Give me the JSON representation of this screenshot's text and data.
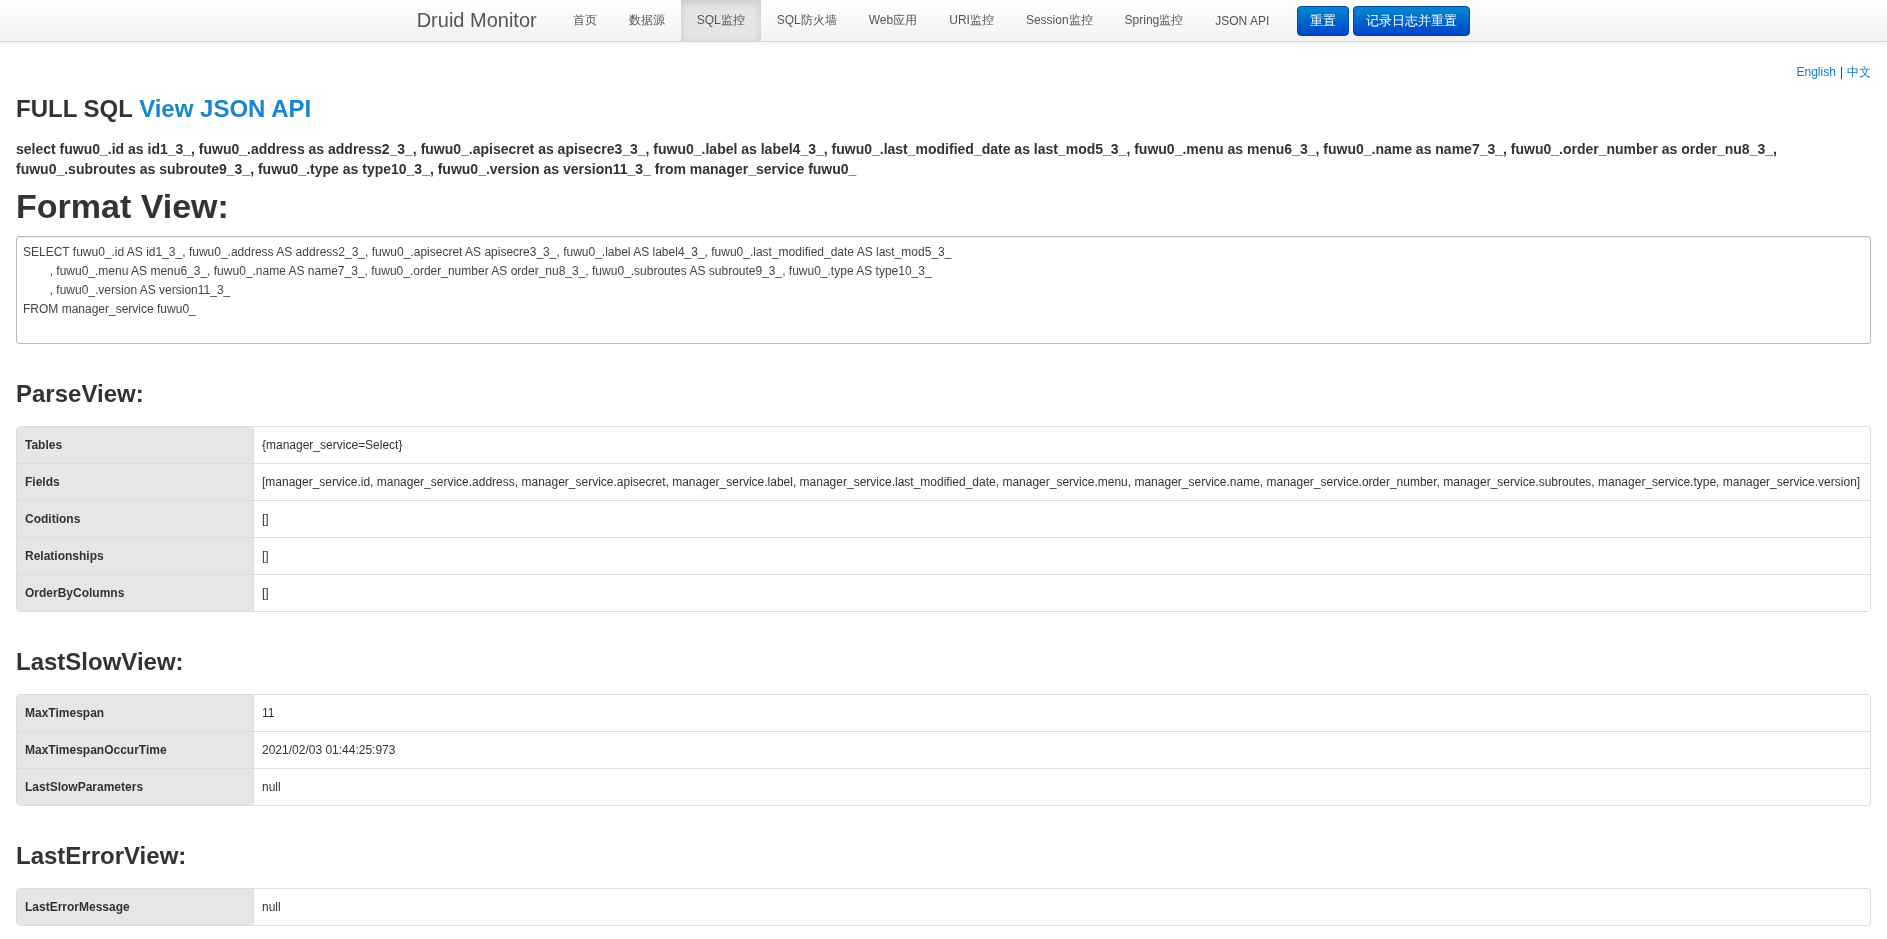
{
  "navbar": {
    "brand": "Druid Monitor",
    "items": [
      {
        "label": "首页",
        "selected": false
      },
      {
        "label": "数据源",
        "selected": false
      },
      {
        "label": "SQL监控",
        "selected": true
      },
      {
        "label": "SQL防火墙",
        "selected": false
      },
      {
        "label": "Web应用",
        "selected": false
      },
      {
        "label": "URI监控",
        "selected": false
      },
      {
        "label": "Session监控",
        "selected": false
      },
      {
        "label": "Spring监控",
        "selected": false
      },
      {
        "label": "JSON API",
        "selected": false
      }
    ],
    "buttons": [
      "重置",
      "记录日志并重置"
    ]
  },
  "languages": [
    "English",
    "中文"
  ],
  "language_separator": "|",
  "full_sql": {
    "title": "FULL SQL",
    "link": "View JSON API",
    "text": "select fuwu0_.id as id1_3_, fuwu0_.address as address2_3_, fuwu0_.apisecret as apisecre3_3_, fuwu0_.label as label4_3_, fuwu0_.last_modified_date as last_mod5_3_, fuwu0_.menu as menu6_3_, fuwu0_.name as name7_3_, fuwu0_.order_number as order_nu8_3_, fuwu0_.subroutes as subroute9_3_, fuwu0_.type as type10_3_, fuwu0_.version as version11_3_ from manager_service fuwu0_"
  },
  "format_view": {
    "title": "Format View:",
    "lines": [
      "SELECT fuwu0_.id AS id1_3_, fuwu0_.address AS address2_3_, fuwu0_.apisecret AS apisecre3_3_, fuwu0_.label AS label4_3_, fuwu0_.last_modified_date AS last_mod5_3_",
      "\t, fuwu0_.menu AS menu6_3_, fuwu0_.name AS name7_3_, fuwu0_.order_number AS order_nu8_3_, fuwu0_.subroutes AS subroute9_3_, fuwu0_.type AS type10_3_",
      "\t, fuwu0_.version AS version11_3_",
      "FROM manager_service fuwu0_"
    ]
  },
  "sections": [
    {
      "title": "ParseView:",
      "rows": [
        {
          "label": "Tables",
          "value": "{manager_service=Select}"
        },
        {
          "label": "Fields",
          "value": "[manager_service.id, manager_service.address, manager_service.apisecret, manager_service.label, manager_service.last_modified_date, manager_service.menu, manager_service.name, manager_service.order_number, manager_service.subroutes, manager_service.type, manager_service.version]"
        },
        {
          "label": "Coditions",
          "value": "[]"
        },
        {
          "label": "Relationships",
          "value": "[]"
        },
        {
          "label": "OrderByColumns",
          "value": "[]"
        }
      ]
    },
    {
      "title": "LastSlowView:",
      "rows": [
        {
          "label": "MaxTimespan",
          "value": "11"
        },
        {
          "label": "MaxTimespanOccurTime",
          "value": "2021/02/03 01:44:25:973"
        },
        {
          "label": "LastSlowParameters",
          "value": "null"
        }
      ]
    },
    {
      "title": "LastErrorView:",
      "rows": [
        {
          "label": "LastErrorMessage",
          "value": "null"
        }
      ]
    }
  ]
}
